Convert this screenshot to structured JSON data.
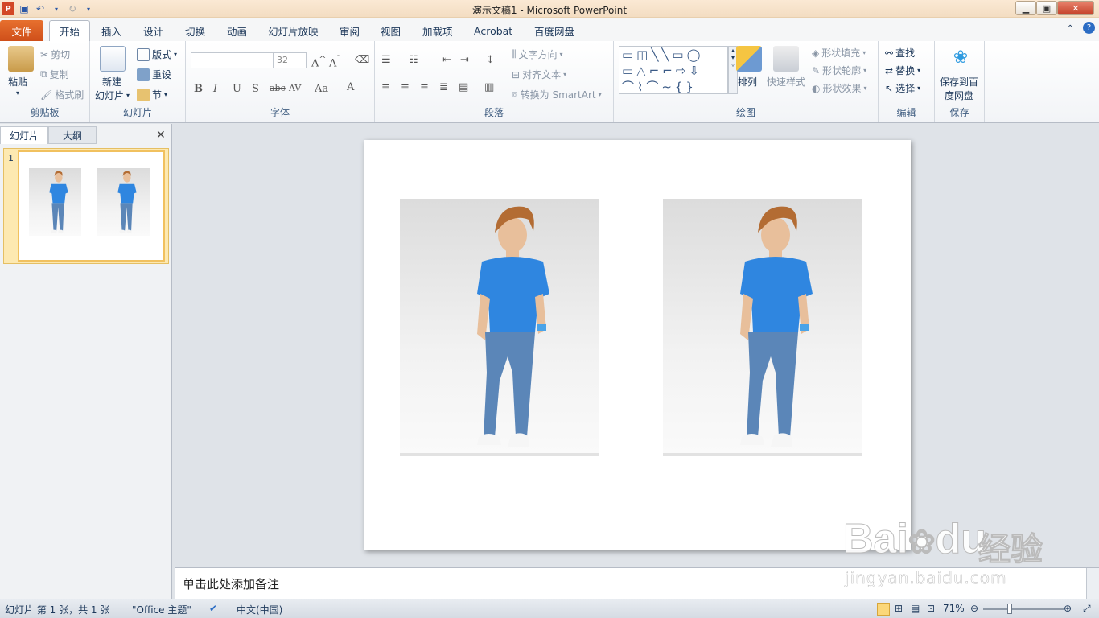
{
  "title": "演示文稿1  -  Microsoft PowerPoint",
  "tabs": [
    "文件",
    "开始",
    "插入",
    "设计",
    "切换",
    "动画",
    "幻灯片放映",
    "审阅",
    "视图",
    "加载项",
    "Acrobat",
    "百度网盘"
  ],
  "clipboard": {
    "paste": "粘贴",
    "cut": "剪切",
    "copy": "复制",
    "painter": "格式刷",
    "label": "剪贴板"
  },
  "slides_group": {
    "new": "新建",
    "new2": "幻灯片",
    "layout": "版式",
    "reset": "重设",
    "section": "节",
    "label": "幻灯片"
  },
  "font_group": {
    "font_name": "",
    "font_size": "32",
    "label": "字体"
  },
  "paragraph_group": {
    "text_dir": "文字方向",
    "align_text": "对齐文本",
    "smartart": "转换为 SmartArt",
    "label": "段落"
  },
  "drawing_group": {
    "arrange": "排列",
    "quick_styles": "快速样式",
    "fill": "形状填充",
    "outline": "形状轮廓",
    "effects": "形状效果",
    "label": "绘图"
  },
  "editing_group": {
    "find": "查找",
    "replace": "替换",
    "select": "选择",
    "label": "编辑"
  },
  "save_group": {
    "save1": "保存到百",
    "save2": "度网盘",
    "label": "保存"
  },
  "panel_tabs": {
    "slides": "幻灯片",
    "outline": "大纲"
  },
  "slide_number": "1",
  "notes_placeholder": "单击此处添加备注",
  "status": {
    "slide_info": "幻灯片 第 1 张，共 1 张",
    "theme": "\"Office 主题\"",
    "language": "中文(中国)",
    "zoom": "71%"
  },
  "watermark": {
    "brand": "Bai",
    "brand2": "du",
    "brand_cn": "经验",
    "url": "jingyan.baidu.com"
  },
  "colors": {
    "accent_orange": "#cf4f1a",
    "shirt": "#2f86e0",
    "jeans": "#5b86b8",
    "selected_thumb": "#f1c15f"
  }
}
